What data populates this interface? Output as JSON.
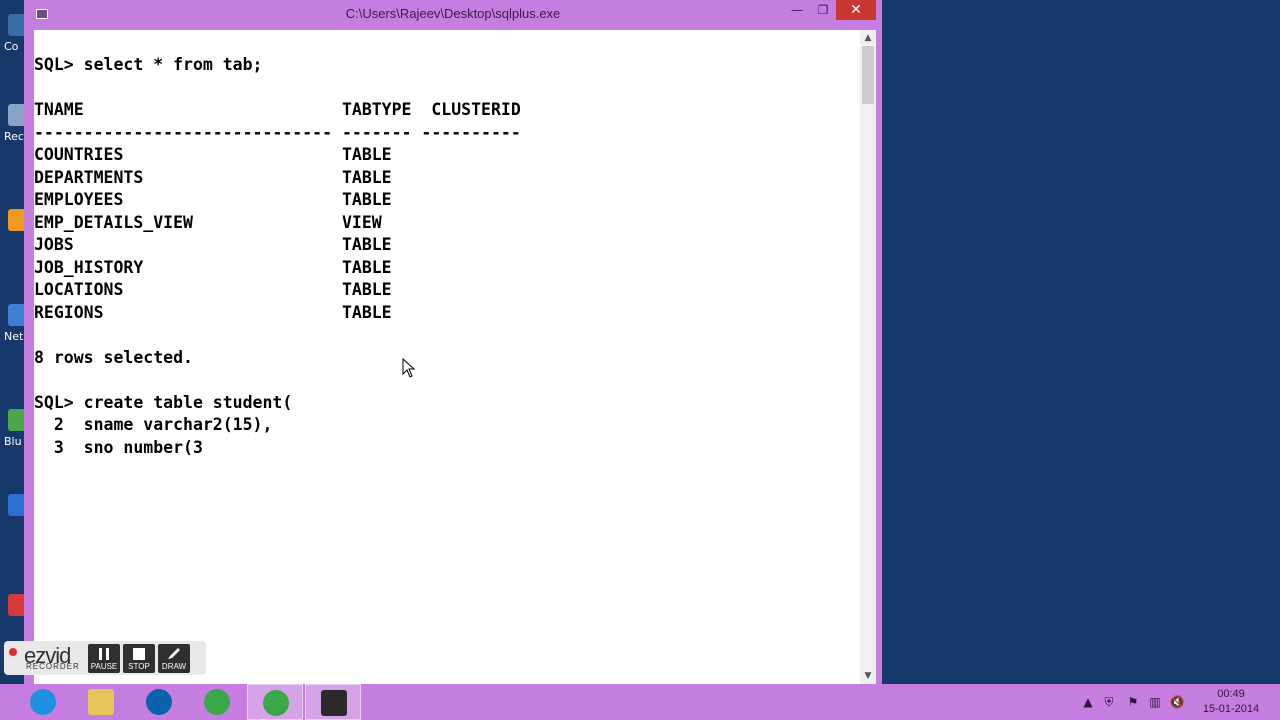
{
  "desktop": {
    "icons": [
      {
        "label": "Co",
        "color": "#3a6ea8"
      },
      {
        "label": "Rec",
        "color": "#8aa4c8"
      },
      {
        "label": "",
        "color": "#f29a1e"
      },
      {
        "label": "NetB",
        "color": "#3d7fd1"
      },
      {
        "label": "Blu",
        "color": "#4aa84a"
      },
      {
        "label": "",
        "color": "#2f6fd1"
      },
      {
        "label": "",
        "color": "#d83a3a"
      }
    ]
  },
  "window": {
    "title": "C:\\Users\\Rajeev\\Desktop\\sqlplus.exe",
    "minimize_label": "—",
    "maximize_label": "❐",
    "close_label": "✕"
  },
  "console": {
    "lines": [
      "SQL> select * from tab;",
      "",
      "TNAME                          TABTYPE  CLUSTERID",
      "------------------------------ ------- ----------",
      "COUNTRIES                      TABLE",
      "DEPARTMENTS                    TABLE",
      "EMPLOYEES                      TABLE",
      "EMP_DETAILS_VIEW               VIEW",
      "JOBS                           TABLE",
      "JOB_HISTORY                    TABLE",
      "LOCATIONS                      TABLE",
      "REGIONS                        TABLE",
      "",
      "8 rows selected.",
      "",
      "SQL> create table student(",
      "  2  sname varchar2(15),",
      "  3  sno number(3"
    ]
  },
  "recorder": {
    "logo": "ezvid",
    "subtitle": "RECORDER",
    "buttons": [
      {
        "label": "PAUSE",
        "icon": "pause-icon"
      },
      {
        "label": "STOP",
        "icon": "stop-icon"
      },
      {
        "label": "DRAW",
        "icon": "draw-icon"
      }
    ]
  },
  "taskbar": {
    "apps": [
      {
        "name": "internet-explorer",
        "color": "#1f8fe0"
      },
      {
        "name": "file-explorer",
        "color": "#e8c45a"
      },
      {
        "name": "hp",
        "color": "#0a62ad"
      },
      {
        "name": "chrome",
        "color": "#3aa84a"
      },
      {
        "name": "chrome-active",
        "color": "#3aa84a"
      },
      {
        "name": "sqlplus-console",
        "color": "#2a2a2a"
      }
    ],
    "clock_time": "00:49",
    "clock_date": "15-01-2014"
  }
}
